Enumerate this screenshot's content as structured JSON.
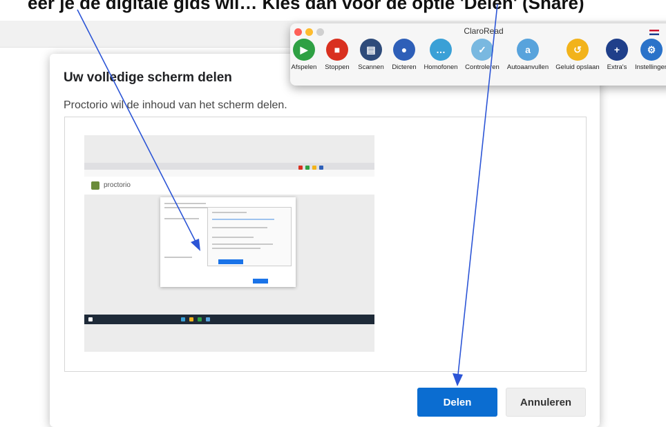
{
  "caption": {
    "text": "eer je de digitale gids wil… Kies dan voor de optie 'Delen' (Share)"
  },
  "dialog": {
    "title": "Uw volledige scherm delen",
    "subtitle": "Proctorio wil de inhoud van het scherm delen.",
    "preview_logo_text": "proctorio",
    "share_label": "Delen",
    "cancel_label": "Annuleren",
    "share_color": "#0b6dd1"
  },
  "claroread": {
    "title": "ClaroRead",
    "tools": [
      {
        "label": "Afspelen",
        "icon": "play-icon",
        "color": "#2ea043",
        "glyph": "▶"
      },
      {
        "label": "Stoppen",
        "icon": "stop-icon",
        "color": "#d9301f",
        "glyph": "■"
      },
      {
        "label": "Scannen",
        "icon": "scanner-icon",
        "color": "#2e4b7a",
        "glyph": "▤"
      },
      {
        "label": "Dicteren",
        "icon": "microphone-icon",
        "color": "#2e5fb8",
        "glyph": "🎙"
      },
      {
        "label": "Homofonen",
        "icon": "speech-bubble-icon",
        "color": "#3aa0d6",
        "glyph": "…"
      },
      {
        "label": "Controleren",
        "icon": "spellcheck-icon",
        "color": "#79b8e0",
        "glyph": "✓"
      },
      {
        "label": "Autoaanvullen",
        "icon": "autocomplete-icon",
        "color": "#58a3dc",
        "glyph": "a"
      },
      {
        "label": "Geluid opslaan",
        "icon": "save-audio-icon",
        "color": "#f2b31b",
        "glyph": "↺"
      },
      {
        "label": "Extra's",
        "icon": "plus-icon",
        "color": "#1f3f8a",
        "glyph": "+"
      },
      {
        "label": "Instellingen",
        "icon": "gear-icon",
        "color": "#2a72c9",
        "glyph": "⚙"
      }
    ]
  }
}
